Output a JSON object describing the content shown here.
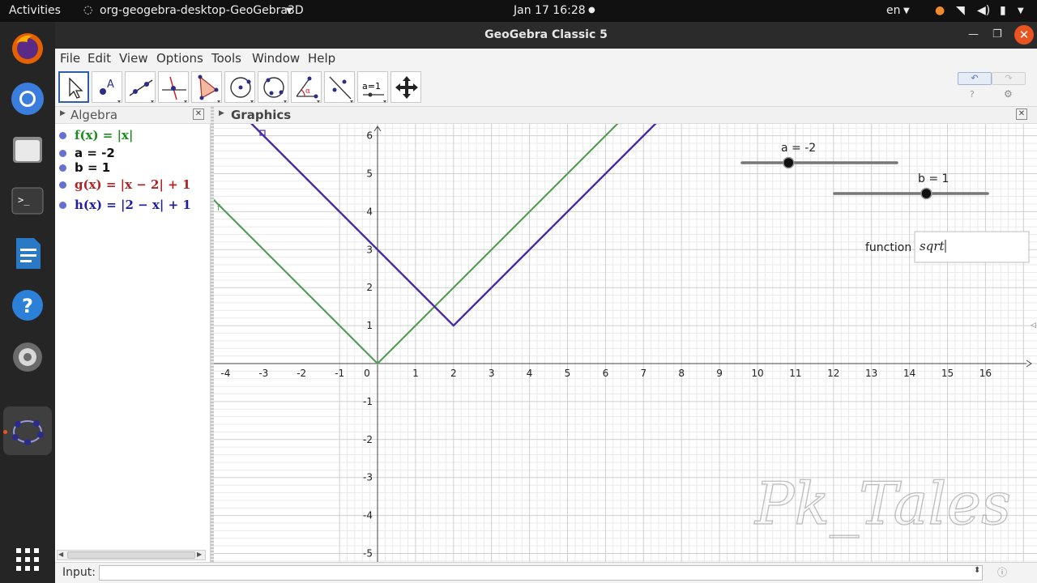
{
  "system_bar": {
    "activities": "Activities",
    "app_name": "org-geogebra-desktop-GeoGebra3D",
    "datetime": "Jan 17  16:28",
    "lang": "en"
  },
  "window": {
    "title": "GeoGebra Classic 5"
  },
  "menu": [
    "File",
    "Edit",
    "View",
    "Options",
    "Tools",
    "Window",
    "Help"
  ],
  "toolbar": {
    "tools": [
      "move-tool",
      "point-tool",
      "line-tool",
      "perpendicular-tool",
      "polygon-tool",
      "circle-tool",
      "circle-three-points-tool",
      "angle-tool",
      "reflect-tool",
      "slider-tool",
      "move-graphics-tool"
    ],
    "slider_tool_label": "a=1"
  },
  "algebra": {
    "title": "Algebra",
    "items": [
      {
        "text": "f(x)  =  |x|",
        "color": "#1d8a1d"
      },
      {
        "text": "a = -2",
        "color": "#111111"
      },
      {
        "text": "b = 1",
        "color": "#111111"
      },
      {
        "text": "g(x)  =  |x − 2| + 1",
        "color": "#b22222"
      },
      {
        "text": "h(x)  =  |2 − x| + 1",
        "color": "#1f1f9e"
      }
    ]
  },
  "graphics": {
    "title": "Graphics",
    "x_ticks": [
      "-4",
      "-3",
      "-2",
      "-1",
      "0",
      "1",
      "2",
      "3",
      "4",
      "5",
      "6",
      "7",
      "8",
      "9",
      "10",
      "11",
      "12",
      "13",
      "14",
      "15",
      "16"
    ],
    "y_ticks": [
      "6",
      "5",
      "4",
      "3",
      "2",
      "1",
      "-1",
      "-2",
      "-3",
      "-4",
      "-5"
    ],
    "colors": {
      "f": "#5b9a5b",
      "h": "#4a2aa0",
      "grid_minor": "#eaeaea",
      "grid_major": "#cfcfcf"
    },
    "slider_a": {
      "label": "a = -2",
      "value": -2,
      "min": -5,
      "max": 5
    },
    "slider_b": {
      "label": "b = 1",
      "value": 1,
      "min": -5,
      "max": 5
    },
    "input_box": {
      "label": "function",
      "value": "sqrt"
    },
    "watermark": "Pk_Tales"
  },
  "input": {
    "label": "Input:",
    "value": ""
  }
}
